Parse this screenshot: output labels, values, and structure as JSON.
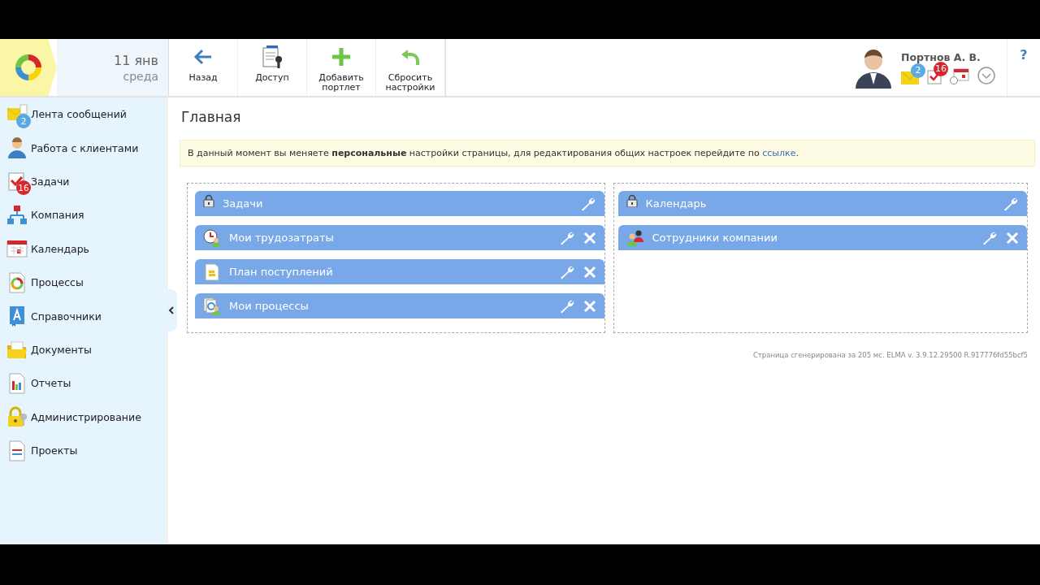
{
  "header": {
    "date": "11 янв",
    "weekday": "среда",
    "toolbar": [
      {
        "kind": "back",
        "label": "Назад"
      },
      {
        "kind": "access",
        "label": "Доступ"
      },
      {
        "kind": "add",
        "label": "Добавить портлет"
      },
      {
        "kind": "reset",
        "label": "Сбросить настройки"
      }
    ],
    "user": {
      "name": "Портнов А. В.",
      "messages_badge": "2",
      "tasks_badge": "16"
    },
    "help": "?"
  },
  "sidebar": {
    "items": [
      {
        "kind": "messages",
        "label": "Лента сообщений",
        "badge": "2",
        "color": "#5aa9e0"
      },
      {
        "kind": "clients",
        "label": "Работа с клиентами"
      },
      {
        "kind": "tasks",
        "label": "Задачи",
        "badge": "16",
        "color": "#d8262e"
      },
      {
        "kind": "company",
        "label": "Компания"
      },
      {
        "kind": "calendar",
        "label": "Календарь"
      },
      {
        "kind": "processes",
        "label": "Процессы"
      },
      {
        "kind": "directories",
        "label": "Справочники"
      },
      {
        "kind": "documents",
        "label": "Документы"
      },
      {
        "kind": "reports",
        "label": "Отчеты"
      },
      {
        "kind": "admin",
        "label": "Администрирование"
      },
      {
        "kind": "projects",
        "label": "Проекты"
      }
    ]
  },
  "page": {
    "title": "Главная",
    "notice": "В данный момент вы меняете **персональные** настройки страницы, для редактирования общих настроек перейдите по ",
    "notice_link": "ссылке",
    "notice_end": ".",
    "columns": [
      {
        "portlets": [
          {
            "title": "Задачи",
            "locked": true,
            "kind": "lock"
          },
          {
            "title": "Мои трудозатраты",
            "locked": false,
            "kind": "time"
          },
          {
            "title": "План поступлений",
            "locked": false,
            "kind": "plan"
          },
          {
            "title": "Мои процессы",
            "locked": false,
            "kind": "process"
          }
        ]
      },
      {
        "portlets": [
          {
            "title": "Календарь",
            "locked": true,
            "kind": "lock"
          },
          {
            "title": "Сотрудники компании",
            "locked": false,
            "kind": "employees"
          }
        ]
      }
    ],
    "footer": "Страница сгенерирована за 205 мс. ELMA v. 3.9.12.29500 R.917776fd55bcf5"
  }
}
